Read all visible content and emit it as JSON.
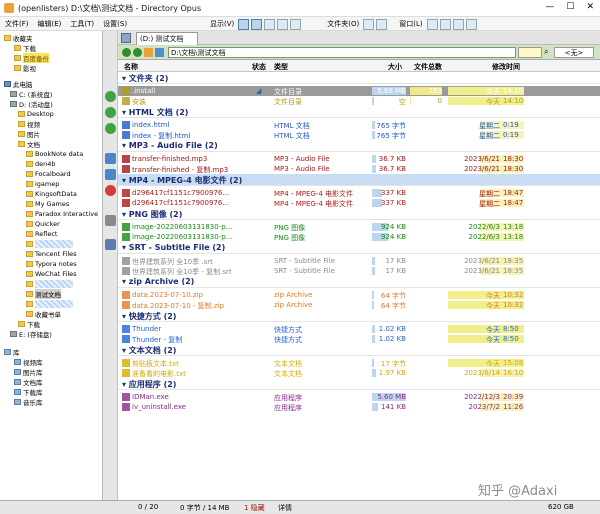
{
  "window": {
    "title": "(openlisters) D:\\文档\\测试文档 - Directory Opus"
  },
  "menu": [
    "文件(F)",
    "编辑(E)",
    "工具(T)",
    "设置(S)"
  ],
  "toolbar": {
    "view": "显示(V)",
    "folder": "文件夹(O)",
    "window": "窗口(L)"
  },
  "tree": {
    "favorites": "收藏夹",
    "fav_items": [
      "下载",
      "百度备份",
      "影视"
    ],
    "pc": "此电脑",
    "drives": [
      "C: (系统盘)",
      "D: (活动盘)"
    ],
    "d_items": [
      "Desktop",
      "视频",
      "图片",
      "文档"
    ],
    "doc_items": [
      "BookNote data",
      "den4b",
      "Focalboard",
      "igamep",
      "KingsoftData",
      "My Games",
      "Paradox Interactive",
      "Quicker",
      "Reflect",
      "",
      "Tencent Files",
      "Typora notes",
      "WeChat Files",
      "",
      "测试文档",
      "",
      "收藏书单"
    ],
    "after": [
      "下载",
      "E: (存储盘)"
    ],
    "library": "库",
    "lib_items": [
      "视频库",
      "图片库",
      "文档库",
      "下载库",
      "音乐库"
    ]
  },
  "tab": "(D:) 测试文档",
  "path": "D:\\文档\\测试文档",
  "filter_none": "<无>",
  "columns": {
    "name": "名称",
    "status": "状态",
    "type": "类型",
    "size": "大小",
    "total": "文件总数",
    "modified": "修改时间"
  },
  "groups": [
    {
      "title": "文件夹 (2)",
      "rows": [
        {
          "name": ".install",
          "type": "文件目录",
          "size": "5.68 MB",
          "count": "253",
          "date": "今天",
          "time": "14:10"
        },
        {
          "name": "安装",
          "type": "文件目录",
          "size": "空",
          "count": "0",
          "date": "今天",
          "time": "14:10"
        }
      ]
    },
    {
      "title": "HTML 文档 (2)",
      "rows": [
        {
          "name": "index.html",
          "type": "HTML 文档",
          "size": "765 字节",
          "count": "",
          "date": "星期二",
          "time": "0:19"
        },
        {
          "name": "index - 复制.html",
          "type": "HTML 文档",
          "size": "765 字节",
          "count": "",
          "date": "星期二",
          "time": "0:19"
        }
      ]
    },
    {
      "title": "MP3 - Audio File (2)",
      "rows": [
        {
          "name": "transfer-finished.mp3",
          "type": "MP3 - Audio File",
          "size": "36.7 KB",
          "count": "",
          "date": "2023/6/21",
          "time": "18:30"
        },
        {
          "name": "transfer-finished - 复制.mp3",
          "type": "MP3 - Audio File",
          "size": "36.7 KB",
          "count": "",
          "date": "2023/6/21",
          "time": "18:30"
        }
      ]
    },
    {
      "title": "MP4 - MPEG-4 电影文件 (2)",
      "rows": [
        {
          "name": "d296417cf1151c7900976...",
          "type": "MP4 - MPEG-4 电影文件",
          "size": "337 KB",
          "count": "",
          "date": "星期二",
          "time": "18:47"
        },
        {
          "name": "d296417cf1151c7900976...",
          "type": "MP4 - MPEG-4 电影文件",
          "size": "337 KB",
          "count": "",
          "date": "星期二",
          "time": "18:47"
        }
      ]
    },
    {
      "title": "PNG 图像 (2)",
      "rows": [
        {
          "name": "image-20220603131830-p...",
          "type": "PNG 图像",
          "size": "924 KB",
          "count": "",
          "date": "2022/6/3",
          "time": "13:18"
        },
        {
          "name": "image-20220603131830-p...",
          "type": "PNG 图像",
          "size": "924 KB",
          "count": "",
          "date": "2022/6/3",
          "time": "13:18"
        }
      ]
    },
    {
      "title": "SRT - Subtitle File (2)",
      "rows": [
        {
          "name": "世界建筑系列 全10季 .srt",
          "type": "SRT - Subtitle File",
          "size": "17 KB",
          "count": "",
          "date": "2023/6/21",
          "time": "18:35"
        },
        {
          "name": "世界建筑系列 全10季 - 复制.srt",
          "type": "SRT - Subtitle File",
          "size": "17 KB",
          "count": "",
          "date": "2023/6/21",
          "time": "18:35"
        }
      ]
    },
    {
      "title": "zip Archive (2)",
      "rows": [
        {
          "name": "data.2023-07-10.zip",
          "type": "zip Archive",
          "size": "64 字节",
          "count": "",
          "date": "今天",
          "time": "10:32"
        },
        {
          "name": "data.2023-07-10 - 复制.zip",
          "type": "zip Archive",
          "size": "64 字节",
          "count": "",
          "date": "今天",
          "time": "10:32"
        }
      ]
    },
    {
      "title": "快捷方式 (2)",
      "rows": [
        {
          "name": "Thunder",
          "type": "快捷方式",
          "size": "1.02 KB",
          "count": "",
          "date": "今天",
          "time": "8:50"
        },
        {
          "name": "Thunder - 复制",
          "type": "快捷方式",
          "size": "1.02 KB",
          "count": "",
          "date": "今天",
          "time": "8:50"
        }
      ]
    },
    {
      "title": "文本文档 (2)",
      "rows": [
        {
          "name": "剪贴板文本.txt",
          "type": "文本文档",
          "size": "17 字节",
          "count": "",
          "date": "今天",
          "time": "15:08"
        },
        {
          "name": "准备看的电影.txt",
          "type": "文本文档",
          "size": "1.97 KB",
          "count": "",
          "date": "2023/6/14",
          "time": "16:10"
        }
      ]
    },
    {
      "title": "应用程序 (2)",
      "rows": [
        {
          "name": "IDMan.exe",
          "type": "应用程序",
          "size": "5.60 MB",
          "count": "",
          "date": "2022/12/3",
          "time": "20:39"
        },
        {
          "name": "iv_uninstall.exe",
          "type": "应用程序",
          "size": "141 KB",
          "count": "",
          "date": "2023/7/2",
          "time": "11:26"
        }
      ]
    }
  ],
  "status": {
    "sel": "0 / 20",
    "bytes": "0 字节 / 14 MB",
    "hidden": "1 隐藏",
    "details": "详情",
    "free": "620 GB"
  },
  "watermark": "知乎 @Adaxi",
  "colors": {
    "folder": "#b49a18",
    "html": "#1f57c8",
    "mp3": "#a41818",
    "mp4": "#b01818",
    "png": "#178a17",
    "srt": "#8a8a8a",
    "zip": "#e07a28",
    "lnk": "#1e64d6",
    "txt": "#d6a800",
    "exe": "#8a2a8a"
  }
}
